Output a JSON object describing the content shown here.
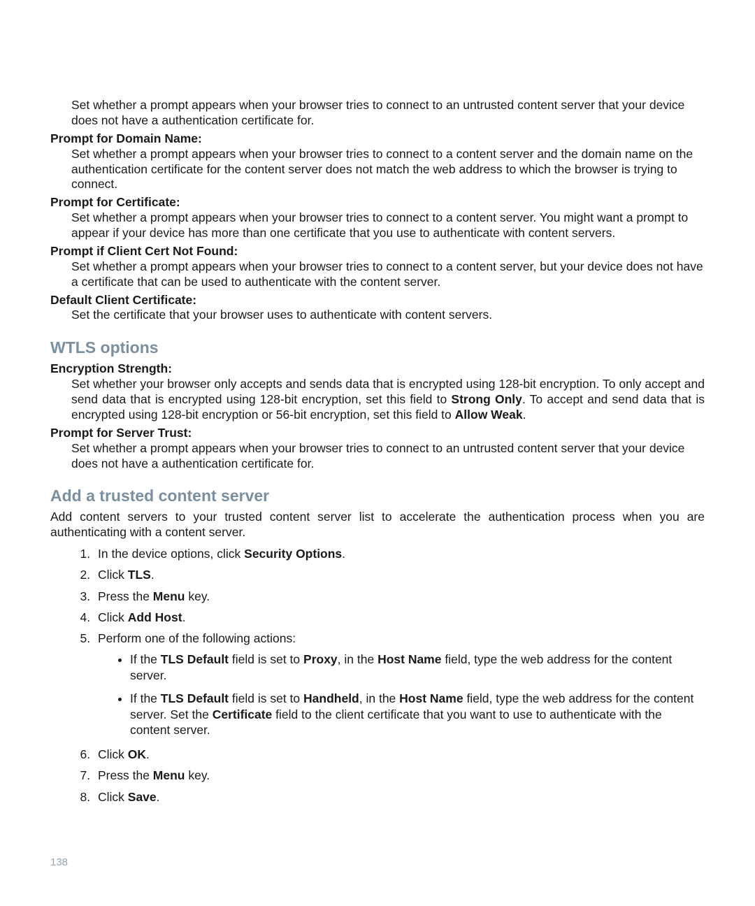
{
  "intro_desc": "Set whether a prompt appears when your browser tries to connect to an untrusted content server that your device does not have a authentication certificate for.",
  "items": [
    {
      "term": "Prompt for Domain Name:",
      "desc": "Set whether a prompt appears when your browser tries to connect to a content server and the domain name on the authentication certificate for the content server does not match the web address to which the browser is trying to connect."
    },
    {
      "term": "Prompt for Certificate:",
      "desc": "Set whether a prompt appears when your browser tries to connect to a content server. You might want a prompt to appear if your device has more than one certificate that you use to authenticate with content servers."
    },
    {
      "term": "Prompt if Client Cert Not Found:",
      "desc": "Set whether a prompt appears when your browser tries to connect to a content server, but your device does not have a certificate that can be used to authenticate with the content server."
    },
    {
      "term": "Default Client Certificate:",
      "desc": "Set the certificate that your browser uses to authenticate with content servers."
    }
  ],
  "wtls": {
    "heading": "WTLS options",
    "enc_term": "Encryption Strength:",
    "enc_desc_a": "Set whether your browser only accepts and sends data that is encrypted using 128-bit encryption. To only accept and send data that is encrypted using 128-bit encryption, set this field to ",
    "enc_bold_a": "Strong Only",
    "enc_desc_b": ". To accept and send data that is encrypted using 128-bit encryption or 56-bit encryption, set this field to ",
    "enc_bold_b": "Allow Weak",
    "enc_desc_c": ".",
    "trust_term": "Prompt for Server Trust:",
    "trust_desc": "Set whether a prompt appears when your browser tries to connect to an untrusted content server that your device does not have a authentication certificate for."
  },
  "add": {
    "heading": "Add a trusted content server",
    "intro": "Add content servers to your trusted content server list to accelerate the authentication process when you are authenticating with a content server.",
    "s1a": "In the device options, click ",
    "s1b": "Security Options",
    "s1c": ".",
    "s2a": "Click ",
    "s2b": "TLS",
    "s2c": ".",
    "s3a": "Press the ",
    "s3b": "Menu",
    "s3c": " key.",
    "s4a": "Click ",
    "s4b": "Add Host",
    "s4c": ".",
    "s5": "Perform one of the following actions:",
    "s5_b1_a": "If the ",
    "s5_b1_b": "TLS Default",
    "s5_b1_c": " field is set to ",
    "s5_b1_d": "Proxy",
    "s5_b1_e": ", in the ",
    "s5_b1_f": "Host Name",
    "s5_b1_g": " field, type the web address for the content server.",
    "s5_b2_a": "If the ",
    "s5_b2_b": "TLS Default",
    "s5_b2_c": " field is set to ",
    "s5_b2_d": "Handheld",
    "s5_b2_e": ", in the ",
    "s5_b2_f": "Host Name",
    "s5_b2_g": " field, type the web address for the content server. Set the ",
    "s5_b2_h": "Certificate",
    "s5_b2_i": " field to the client certificate that you want to use to authenticate with the content server.",
    "s6a": "Click ",
    "s6b": "OK",
    "s6c": ".",
    "s7a": "Press the ",
    "s7b": "Menu",
    "s7c": " key.",
    "s8a": "Click ",
    "s8b": "Save",
    "s8c": "."
  },
  "page_number": "138"
}
